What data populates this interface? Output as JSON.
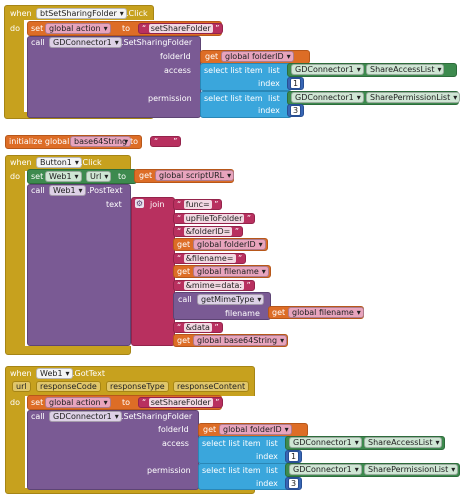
{
  "colors": {
    "event": "#c7a11e",
    "call": "#7a5a94",
    "text": "#b8305f",
    "variable": "#dd6d26",
    "list": "#3aa6dc",
    "component": "#3d8a4e",
    "number": "#3866b5"
  },
  "block1": {
    "when": "when",
    "component": "btSetSharingFolder",
    "event": ".Click",
    "do": "do",
    "set": "set",
    "var": "global action",
    "to": "to",
    "value": "setShareFolder",
    "call": "call",
    "call_component": "GDConnector1",
    "method": ".SetSharingFolder",
    "folderid_label": "folderId",
    "get": "get",
    "folderid_var": "global folderID",
    "access_label": "access",
    "select1": "select list item",
    "list": "list",
    "comp2": "GDConnector1",
    "prop1": "ShareAccessList",
    "index": "index",
    "idx1": "1",
    "permission_label": "permission",
    "select2": "select list item",
    "comp3": "GDConnector1",
    "prop2": "SharePermissionList",
    "idx2": "3"
  },
  "init": {
    "label": "initialize global",
    "name": "base64String",
    "to": "to",
    "value": ""
  },
  "block2": {
    "when": "when",
    "component": "Button1",
    "event": ".Click",
    "do": "do",
    "set": "set",
    "comp": "Web1",
    "prop": "Url",
    "to": "to",
    "get": "get",
    "var": "global scriptURL",
    "call": "call",
    "call_comp": "Web1",
    "method": ".PostText",
    "text_label": "text",
    "join": "join",
    "j1": "func=",
    "j2": "upFileToFolder",
    "j3": "&folderID=",
    "j4": "global folderID",
    "j5": "&filename=",
    "j6": "global filename",
    "j7": "&mime=data:",
    "j8_call": "call",
    "j8_method": "getMimeType",
    "j8_filename_label": "filename",
    "j8_var": "global filename",
    "j9": "&data",
    "j10": "global base64String"
  },
  "block3": {
    "when": "when",
    "component": "Web1",
    "event": ".GotText",
    "params": [
      "url",
      "responseCode",
      "responseType",
      "responseContent"
    ],
    "do": "do",
    "set": "set",
    "var": "global action",
    "to": "to",
    "value": "setShareFolder",
    "call": "call",
    "call_component": "GDConnector1",
    "method": ".SetSharingFolder",
    "folderid_label": "folderId",
    "get": "get",
    "folderid_var": "global folderID",
    "access_label": "access",
    "select1": "select list item",
    "list": "list",
    "comp2": "GDConnector1",
    "prop1": "ShareAccessList",
    "index": "index",
    "idx1": "1",
    "permission_label": "permission",
    "select2": "select list item",
    "comp3": "GDConnector1",
    "prop2": "SharePermissionList",
    "idx2": "3"
  }
}
